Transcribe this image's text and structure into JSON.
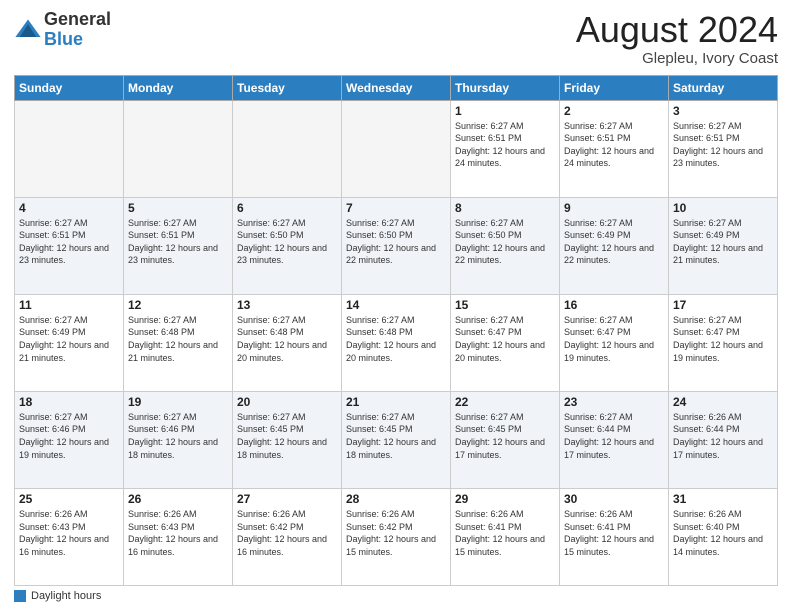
{
  "logo": {
    "general": "General",
    "blue": "Blue"
  },
  "title": "August 2024",
  "location": "Glepleu, Ivory Coast",
  "days_of_week": [
    "Sunday",
    "Monday",
    "Tuesday",
    "Wednesday",
    "Thursday",
    "Friday",
    "Saturday"
  ],
  "footer_label": "Daylight hours",
  "weeks": [
    [
      {
        "day": "",
        "empty": true
      },
      {
        "day": "",
        "empty": true
      },
      {
        "day": "",
        "empty": true
      },
      {
        "day": "",
        "empty": true
      },
      {
        "day": "1",
        "sunrise": "6:27 AM",
        "sunset": "6:51 PM",
        "daylight": "12 hours and 24 minutes."
      },
      {
        "day": "2",
        "sunrise": "6:27 AM",
        "sunset": "6:51 PM",
        "daylight": "12 hours and 24 minutes."
      },
      {
        "day": "3",
        "sunrise": "6:27 AM",
        "sunset": "6:51 PM",
        "daylight": "12 hours and 23 minutes."
      }
    ],
    [
      {
        "day": "4",
        "sunrise": "6:27 AM",
        "sunset": "6:51 PM",
        "daylight": "12 hours and 23 minutes."
      },
      {
        "day": "5",
        "sunrise": "6:27 AM",
        "sunset": "6:51 PM",
        "daylight": "12 hours and 23 minutes."
      },
      {
        "day": "6",
        "sunrise": "6:27 AM",
        "sunset": "6:50 PM",
        "daylight": "12 hours and 23 minutes."
      },
      {
        "day": "7",
        "sunrise": "6:27 AM",
        "sunset": "6:50 PM",
        "daylight": "12 hours and 22 minutes."
      },
      {
        "day": "8",
        "sunrise": "6:27 AM",
        "sunset": "6:50 PM",
        "daylight": "12 hours and 22 minutes."
      },
      {
        "day": "9",
        "sunrise": "6:27 AM",
        "sunset": "6:49 PM",
        "daylight": "12 hours and 22 minutes."
      },
      {
        "day": "10",
        "sunrise": "6:27 AM",
        "sunset": "6:49 PM",
        "daylight": "12 hours and 21 minutes."
      }
    ],
    [
      {
        "day": "11",
        "sunrise": "6:27 AM",
        "sunset": "6:49 PM",
        "daylight": "12 hours and 21 minutes."
      },
      {
        "day": "12",
        "sunrise": "6:27 AM",
        "sunset": "6:48 PM",
        "daylight": "12 hours and 21 minutes."
      },
      {
        "day": "13",
        "sunrise": "6:27 AM",
        "sunset": "6:48 PM",
        "daylight": "12 hours and 20 minutes."
      },
      {
        "day": "14",
        "sunrise": "6:27 AM",
        "sunset": "6:48 PM",
        "daylight": "12 hours and 20 minutes."
      },
      {
        "day": "15",
        "sunrise": "6:27 AM",
        "sunset": "6:47 PM",
        "daylight": "12 hours and 20 minutes."
      },
      {
        "day": "16",
        "sunrise": "6:27 AM",
        "sunset": "6:47 PM",
        "daylight": "12 hours and 19 minutes."
      },
      {
        "day": "17",
        "sunrise": "6:27 AM",
        "sunset": "6:47 PM",
        "daylight": "12 hours and 19 minutes."
      }
    ],
    [
      {
        "day": "18",
        "sunrise": "6:27 AM",
        "sunset": "6:46 PM",
        "daylight": "12 hours and 19 minutes."
      },
      {
        "day": "19",
        "sunrise": "6:27 AM",
        "sunset": "6:46 PM",
        "daylight": "12 hours and 18 minutes."
      },
      {
        "day": "20",
        "sunrise": "6:27 AM",
        "sunset": "6:45 PM",
        "daylight": "12 hours and 18 minutes."
      },
      {
        "day": "21",
        "sunrise": "6:27 AM",
        "sunset": "6:45 PM",
        "daylight": "12 hours and 18 minutes."
      },
      {
        "day": "22",
        "sunrise": "6:27 AM",
        "sunset": "6:45 PM",
        "daylight": "12 hours and 17 minutes."
      },
      {
        "day": "23",
        "sunrise": "6:27 AM",
        "sunset": "6:44 PM",
        "daylight": "12 hours and 17 minutes."
      },
      {
        "day": "24",
        "sunrise": "6:26 AM",
        "sunset": "6:44 PM",
        "daylight": "12 hours and 17 minutes."
      }
    ],
    [
      {
        "day": "25",
        "sunrise": "6:26 AM",
        "sunset": "6:43 PM",
        "daylight": "12 hours and 16 minutes."
      },
      {
        "day": "26",
        "sunrise": "6:26 AM",
        "sunset": "6:43 PM",
        "daylight": "12 hours and 16 minutes."
      },
      {
        "day": "27",
        "sunrise": "6:26 AM",
        "sunset": "6:42 PM",
        "daylight": "12 hours and 16 minutes."
      },
      {
        "day": "28",
        "sunrise": "6:26 AM",
        "sunset": "6:42 PM",
        "daylight": "12 hours and 15 minutes."
      },
      {
        "day": "29",
        "sunrise": "6:26 AM",
        "sunset": "6:41 PM",
        "daylight": "12 hours and 15 minutes."
      },
      {
        "day": "30",
        "sunrise": "6:26 AM",
        "sunset": "6:41 PM",
        "daylight": "12 hours and 15 minutes."
      },
      {
        "day": "31",
        "sunrise": "6:26 AM",
        "sunset": "6:40 PM",
        "daylight": "12 hours and 14 minutes."
      }
    ]
  ]
}
